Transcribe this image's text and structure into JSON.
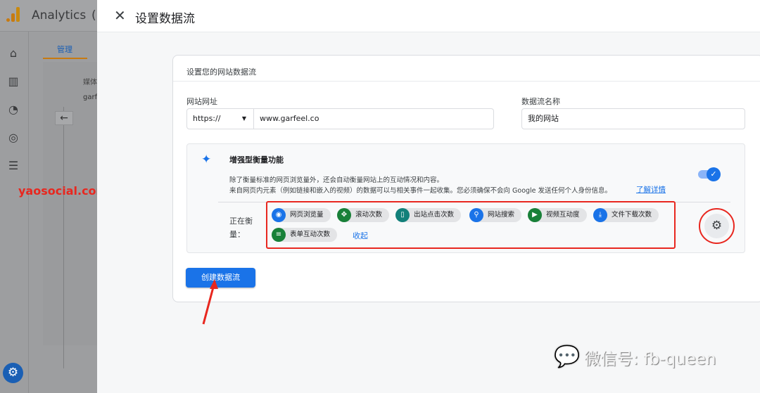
{
  "app": {
    "title": "Analytics",
    "title_suffix": "(",
    "nav_tab": "管理",
    "property_label": "媒体",
    "property_value": "garfe"
  },
  "nav_icons": [
    "home-icon",
    "reports-icon",
    "explore-icon",
    "advertising-icon",
    "list-icon"
  ],
  "dialog": {
    "title": "设置数据流",
    "card_title": "设置您的网站数据流",
    "url_label": "网站网址",
    "protocol": "https://",
    "url_value": "www.garfeel.co",
    "name_label": "数据流名称",
    "name_value": "我的网站",
    "enhanced": {
      "title": "增强型衡量功能",
      "desc1": "除了衡量标准的网页浏览量外，还会自动衡量网站上的互动情况和内容。",
      "desc2": "来自网页内元素（例如链接和嵌入的视频）的数据可以与相关事件一起收集。您必须确保不会向 Google 发送任何个人身份信息。",
      "learn_more": "了解详情",
      "toggle_on": true,
      "measuring_label1": "正在衡",
      "measuring_label2": "量：",
      "chips": [
        {
          "label": "网页浏览量",
          "icon": "eye-icon",
          "color": "#1a73e8"
        },
        {
          "label": "滚动次数",
          "icon": "scroll-icon",
          "color": "#188038"
        },
        {
          "label": "出站点击次数",
          "icon": "mouse-icon",
          "color": "#12807a"
        },
        {
          "label": "网站搜索",
          "icon": "search-icon",
          "color": "#1a73e8"
        },
        {
          "label": "视频互动度",
          "icon": "play-icon",
          "color": "#188038"
        },
        {
          "label": "文件下载次数",
          "icon": "download-icon",
          "color": "#1a73e8"
        },
        {
          "label": "表单互动次数",
          "icon": "form-icon",
          "color": "#188038"
        }
      ],
      "collapse": "收起"
    },
    "create_button": "创建数据流"
  },
  "watermarks": {
    "site": "yaosocial.com",
    "wechat": "微信号: fb-queen"
  },
  "colors": {
    "accent": "#1a73e8",
    "annotation": "#e8271f"
  }
}
